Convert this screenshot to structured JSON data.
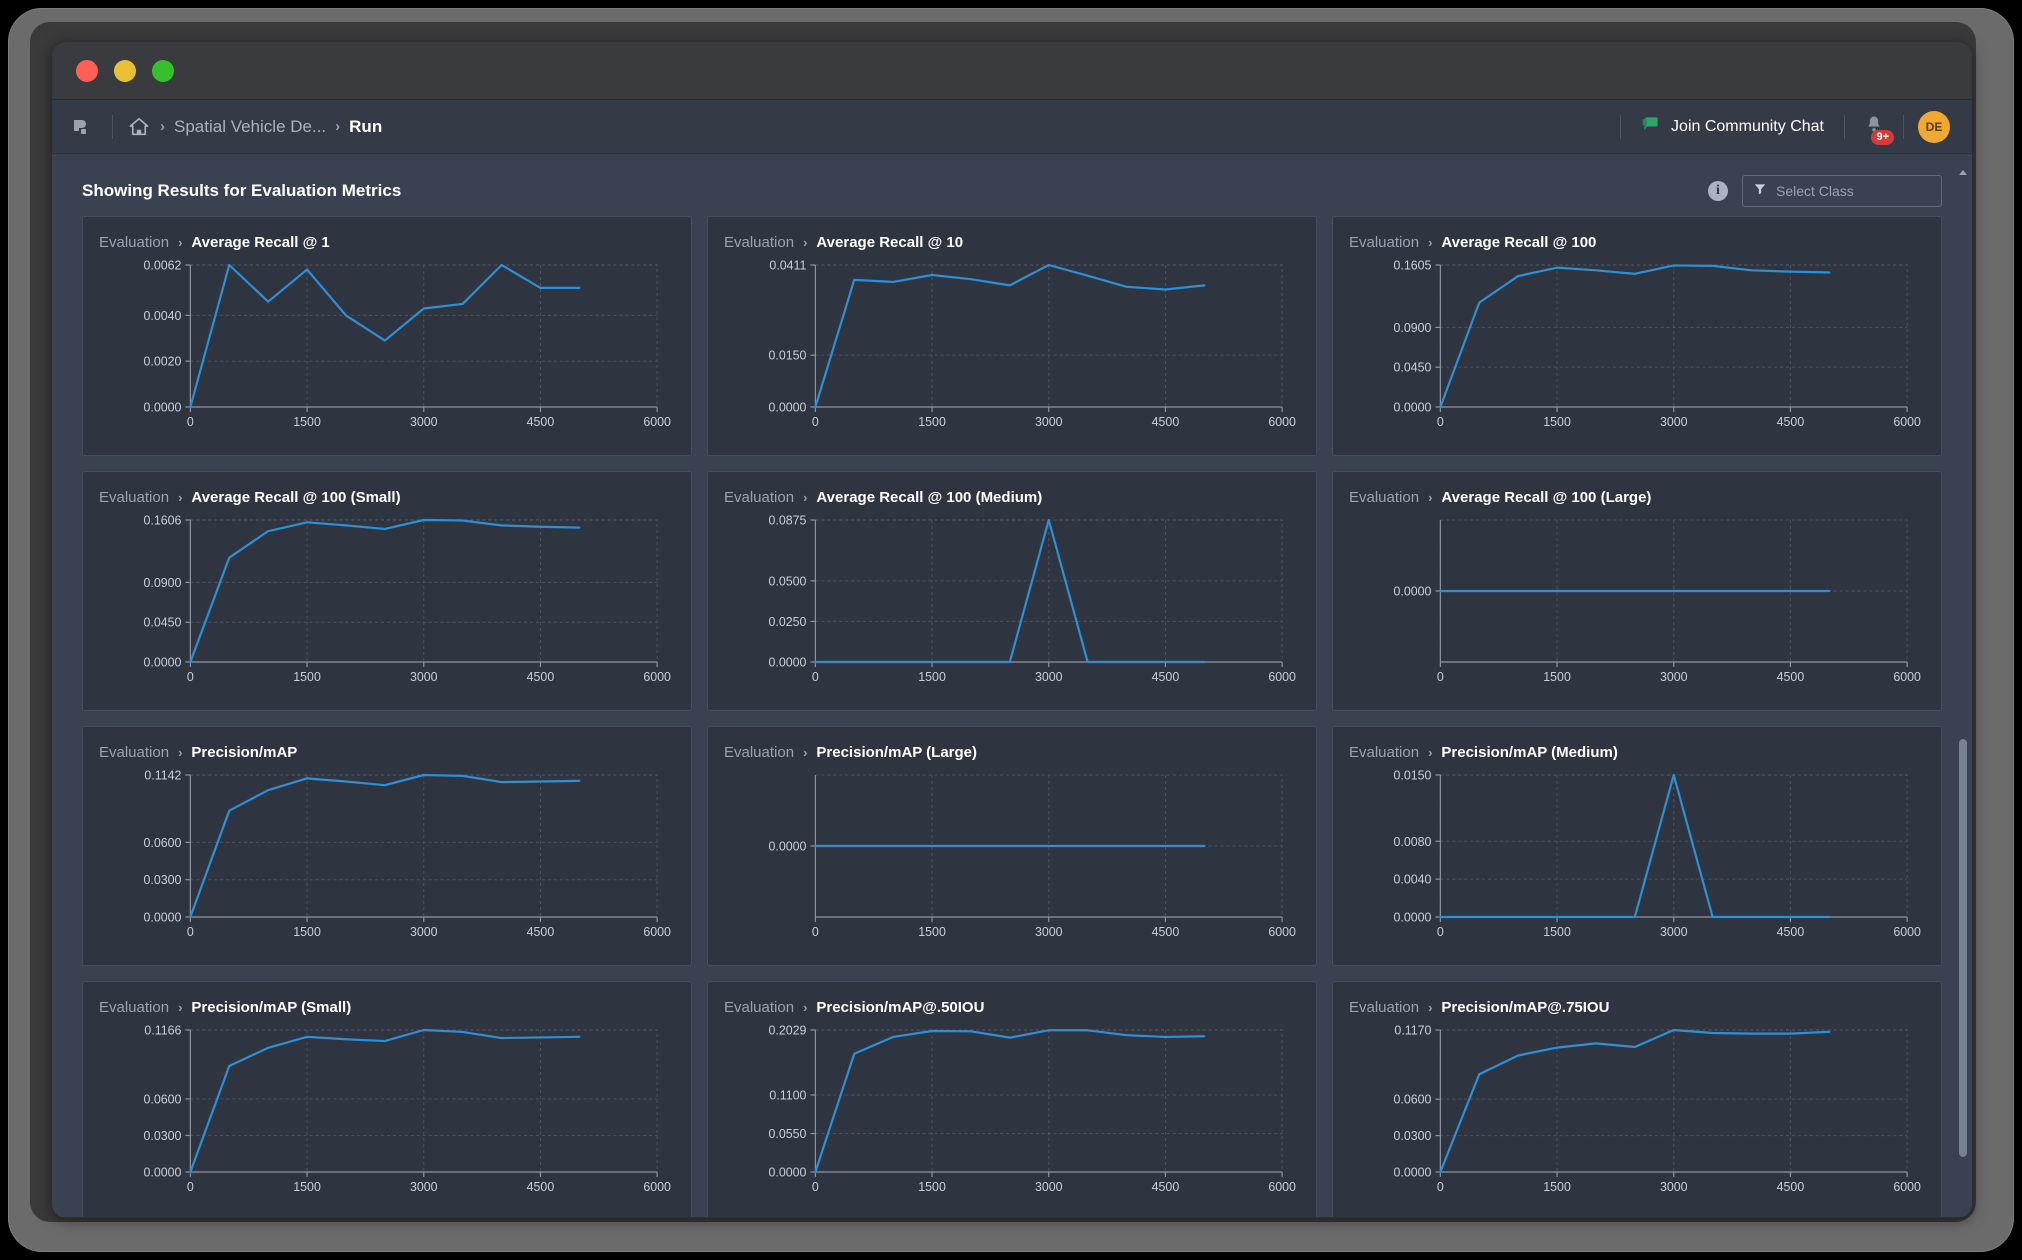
{
  "window": {
    "traffic_lights": [
      "close",
      "minimize",
      "maximize"
    ]
  },
  "navbar": {
    "app_icon": "app-logo-icon",
    "home_icon": "home-icon",
    "breadcrumb": [
      {
        "label": "Spatial Vehicle De...",
        "active": false
      },
      {
        "label": "Run",
        "active": true
      }
    ],
    "separator": "›",
    "chat_button": {
      "label": "Join Community Chat",
      "icon": "chat-bubble-icon",
      "color": "#2fa36a"
    },
    "notifications": {
      "icon": "bell-icon",
      "badge": "9+",
      "badge_color": "#d83a3a"
    },
    "avatar": {
      "initials": "DE",
      "color": "#f0a830"
    }
  },
  "toolbar": {
    "page_title": "Showing Results for Evaluation Metrics",
    "info_icon": "i",
    "select_class": {
      "icon": "filter-icon",
      "placeholder": "Select Class",
      "value": ""
    }
  },
  "cards": [
    {
      "group": "Evaluation",
      "sep": "›",
      "name": "Average Recall @ 1"
    },
    {
      "group": "Evaluation",
      "sep": "›",
      "name": "Average Recall @ 10"
    },
    {
      "group": "Evaluation",
      "sep": "›",
      "name": "Average Recall @ 100"
    },
    {
      "group": "Evaluation",
      "sep": "›",
      "name": "Average Recall @ 100 (Small)"
    },
    {
      "group": "Evaluation",
      "sep": "›",
      "name": "Average Recall @ 100 (Medium)"
    },
    {
      "group": "Evaluation",
      "sep": "›",
      "name": "Average Recall @ 100 (Large)"
    },
    {
      "group": "Evaluation",
      "sep": "›",
      "name": "Precision/mAP"
    },
    {
      "group": "Evaluation",
      "sep": "›",
      "name": "Precision/mAP (Large)"
    },
    {
      "group": "Evaluation",
      "sep": "›",
      "name": "Precision/mAP (Medium)"
    },
    {
      "group": "Evaluation",
      "sep": "›",
      "name": "Precision/mAP (Small)"
    },
    {
      "group": "Evaluation",
      "sep": "›",
      "name": "Precision/mAP@.50IOU"
    },
    {
      "group": "Evaluation",
      "sep": "›",
      "name": "Precision/mAP@.75IOU"
    }
  ],
  "chart_style": {
    "line_color": "#2e8fd4",
    "grid_color": "#5b6270",
    "axis_color": "#8d95a3",
    "tick_color": "#c8cfdb",
    "card_bg": "#2f3540"
  },
  "chart_data": [
    {
      "type": "line",
      "title": "Average Recall @ 1",
      "xlabel": "",
      "ylabel": "",
      "xticks": [
        0,
        1500,
        3000,
        4500,
        6000
      ],
      "yticks": [
        0.0,
        0.002,
        0.004,
        0.0062
      ],
      "ytick_labels": [
        "0.0000",
        "0.0020",
        "0.0040",
        "0.0062"
      ],
      "xlim": [
        0,
        6000
      ],
      "ylim": [
        0,
        0.0062
      ],
      "grid": true,
      "legend": false,
      "x": [
        0,
        500,
        1000,
        1500,
        2000,
        2500,
        3000,
        3500,
        4000,
        4500,
        5000
      ],
      "y": [
        0.0,
        0.0062,
        0.0046,
        0.006,
        0.004,
        0.0029,
        0.0043,
        0.0045,
        0.0062,
        0.0052,
        0.0052
      ]
    },
    {
      "type": "line",
      "title": "Average Recall @ 10",
      "xlabel": "",
      "ylabel": "",
      "xticks": [
        0,
        1500,
        3000,
        4500,
        6000
      ],
      "yticks": [
        0.0,
        0.015,
        0.0411
      ],
      "ytick_labels": [
        "0.0000",
        "0.0150",
        "0.0411"
      ],
      "xlim": [
        0,
        6000
      ],
      "ylim": [
        0,
        0.0411
      ],
      "grid": true,
      "legend": false,
      "x": [
        0,
        500,
        1000,
        1500,
        2000,
        2500,
        3000,
        3500,
        4000,
        4500,
        5000
      ],
      "y": [
        0.0,
        0.0368,
        0.0362,
        0.0382,
        0.037,
        0.0352,
        0.0411,
        0.038,
        0.0348,
        0.034,
        0.0352
      ]
    },
    {
      "type": "line",
      "title": "Average Recall @ 100",
      "xlabel": "",
      "ylabel": "",
      "xticks": [
        0,
        1500,
        3000,
        4500,
        6000
      ],
      "yticks": [
        0.0,
        0.045,
        0.09,
        0.1605
      ],
      "ytick_labels": [
        "0.0000",
        "0.0450",
        "0.0900",
        "0.1605"
      ],
      "xlim": [
        0,
        6000
      ],
      "ylim": [
        0,
        0.1605
      ],
      "grid": true,
      "legend": false,
      "x": [
        0,
        500,
        1000,
        1500,
        2000,
        2500,
        3000,
        3500,
        4000,
        4500,
        5000
      ],
      "y": [
        0.0,
        0.118,
        0.148,
        0.1575,
        0.1545,
        0.1505,
        0.16,
        0.1595,
        0.1545,
        0.153,
        0.152
      ]
    },
    {
      "type": "line",
      "title": "Average Recall @ 100 (Small)",
      "xlabel": "",
      "ylabel": "",
      "xticks": [
        0,
        1500,
        3000,
        4500,
        6000
      ],
      "yticks": [
        0.0,
        0.045,
        0.09,
        0.1606
      ],
      "ytick_labels": [
        "0.0000",
        "0.0450",
        "0.0900",
        "0.1606"
      ],
      "xlim": [
        0,
        6000
      ],
      "ylim": [
        0,
        0.1606
      ],
      "grid": true,
      "legend": false,
      "x": [
        0,
        500,
        1000,
        1500,
        2000,
        2500,
        3000,
        3500,
        4000,
        4500,
        5000
      ],
      "y": [
        0.0,
        0.118,
        0.148,
        0.158,
        0.1545,
        0.1505,
        0.1606,
        0.16,
        0.1545,
        0.153,
        0.152
      ]
    },
    {
      "type": "line",
      "title": "Average Recall @ 100 (Medium)",
      "xlabel": "",
      "ylabel": "",
      "xticks": [
        0,
        1500,
        3000,
        4500,
        6000
      ],
      "yticks": [
        0.0,
        0.025,
        0.05,
        0.0875
      ],
      "ytick_labels": [
        "0.0000",
        "0.0250",
        "0.0500",
        "0.0875"
      ],
      "xlim": [
        0,
        6000
      ],
      "ylim": [
        0,
        0.0875
      ],
      "grid": true,
      "legend": false,
      "x": [
        0,
        500,
        1000,
        1500,
        2000,
        2500,
        3000,
        3500,
        4000,
        4500,
        5000
      ],
      "y": [
        0.0,
        0.0,
        0.0,
        0.0,
        0.0,
        0.0,
        0.0875,
        0.0,
        0.0,
        0.0,
        0.0
      ]
    },
    {
      "type": "line",
      "title": "Average Recall @ 100 (Large)",
      "xlabel": "",
      "ylabel": "",
      "xticks": [
        0,
        1500,
        3000,
        4500,
        6000
      ],
      "yticks": [
        0.0
      ],
      "ytick_labels": [
        "0.0000"
      ],
      "xlim": [
        0,
        6000
      ],
      "ylim": [
        -1,
        1
      ],
      "grid": true,
      "legend": false,
      "x": [
        0,
        5000
      ],
      "y": [
        0.0,
        0.0
      ]
    },
    {
      "type": "line",
      "title": "Precision/mAP",
      "xlabel": "",
      "ylabel": "",
      "xticks": [
        0,
        1500,
        3000,
        4500,
        6000
      ],
      "yticks": [
        0.0,
        0.03,
        0.06,
        0.1142
      ],
      "ytick_labels": [
        "0.0000",
        "0.0300",
        "0.0600",
        "0.1142"
      ],
      "xlim": [
        0,
        6000
      ],
      "ylim": [
        0,
        0.1142
      ],
      "grid": true,
      "legend": false,
      "x": [
        0,
        500,
        1000,
        1500,
        2000,
        2500,
        3000,
        3500,
        4000,
        4500,
        5000
      ],
      "y": [
        0.0,
        0.0855,
        0.102,
        0.1115,
        0.109,
        0.106,
        0.1142,
        0.1135,
        0.1085,
        0.109,
        0.1095
      ]
    },
    {
      "type": "line",
      "title": "Precision/mAP (Large)",
      "xlabel": "",
      "ylabel": "",
      "xticks": [
        0,
        1500,
        3000,
        4500,
        6000
      ],
      "yticks": [
        0.0
      ],
      "ytick_labels": [
        "0.0000"
      ],
      "xlim": [
        0,
        6000
      ],
      "ylim": [
        -1,
        1
      ],
      "grid": true,
      "legend": false,
      "x": [
        0,
        5000
      ],
      "y": [
        0.0,
        0.0
      ]
    },
    {
      "type": "line",
      "title": "Precision/mAP (Medium)",
      "xlabel": "",
      "ylabel": "",
      "xticks": [
        0,
        1500,
        3000,
        4500,
        6000
      ],
      "yticks": [
        0.0,
        0.004,
        0.008,
        0.015
      ],
      "ytick_labels": [
        "0.0000",
        "0.0040",
        "0.0080",
        "0.0150"
      ],
      "xlim": [
        0,
        6000
      ],
      "ylim": [
        0,
        0.015
      ],
      "grid": true,
      "legend": false,
      "x": [
        0,
        500,
        1000,
        1500,
        2000,
        2500,
        3000,
        3500,
        4000,
        4500,
        5000
      ],
      "y": [
        0.0,
        0.0,
        0.0,
        0.0,
        0.0,
        0.0,
        0.015,
        0.0,
        0.0,
        0.0,
        0.0
      ]
    },
    {
      "type": "line",
      "title": "Precision/mAP (Small)",
      "xlabel": "",
      "ylabel": "",
      "xticks": [
        0,
        1500,
        3000,
        4500,
        6000
      ],
      "yticks": [
        0.0,
        0.03,
        0.06,
        0.1166
      ],
      "ytick_labels": [
        "0.0000",
        "0.0300",
        "0.0600",
        "0.1166"
      ],
      "xlim": [
        0,
        6000
      ],
      "ylim": [
        0,
        0.1166
      ],
      "grid": true,
      "legend": false,
      "x": [
        0,
        500,
        1000,
        1500,
        2000,
        2500,
        3000,
        3500,
        4000,
        4500,
        5000
      ],
      "y": [
        0.0,
        0.087,
        0.102,
        0.111,
        0.109,
        0.1075,
        0.1166,
        0.115,
        0.11,
        0.1105,
        0.111
      ]
    },
    {
      "type": "line",
      "title": "Precision/mAP@.50IOU",
      "xlabel": "",
      "ylabel": "",
      "xticks": [
        0,
        1500,
        3000,
        4500,
        6000
      ],
      "yticks": [
        0.0,
        0.055,
        0.11,
        0.2029
      ],
      "ytick_labels": [
        "0.0000",
        "0.0550",
        "0.1100",
        "0.2029"
      ],
      "xlim": [
        0,
        6000
      ],
      "ylim": [
        0,
        0.2029
      ],
      "grid": true,
      "legend": false,
      "x": [
        0,
        500,
        1000,
        1500,
        2000,
        2500,
        3000,
        3500,
        4000,
        4500,
        5000
      ],
      "y": [
        0.0,
        0.169,
        0.193,
        0.2015,
        0.201,
        0.192,
        0.2025,
        0.2025,
        0.1955,
        0.193,
        0.194
      ]
    },
    {
      "type": "line",
      "title": "Precision/mAP@.75IOU",
      "xlabel": "",
      "ylabel": "",
      "xticks": [
        0,
        1500,
        3000,
        4500,
        6000
      ],
      "yticks": [
        0.0,
        0.03,
        0.06,
        0.117
      ],
      "ytick_labels": [
        "0.0000",
        "0.0300",
        "0.0600",
        "0.1170"
      ],
      "xlim": [
        0,
        6000
      ],
      "ylim": [
        0,
        0.117
      ],
      "grid": true,
      "legend": false,
      "x": [
        0,
        500,
        1000,
        1500,
        2000,
        2500,
        3000,
        3500,
        4000,
        4500,
        5000
      ],
      "y": [
        0.0,
        0.0805,
        0.096,
        0.1025,
        0.106,
        0.103,
        0.117,
        0.1145,
        0.114,
        0.114,
        0.1155
      ]
    }
  ],
  "scrollbar": {
    "thumb_top_pct": 55,
    "thumb_height_pct": 40
  }
}
